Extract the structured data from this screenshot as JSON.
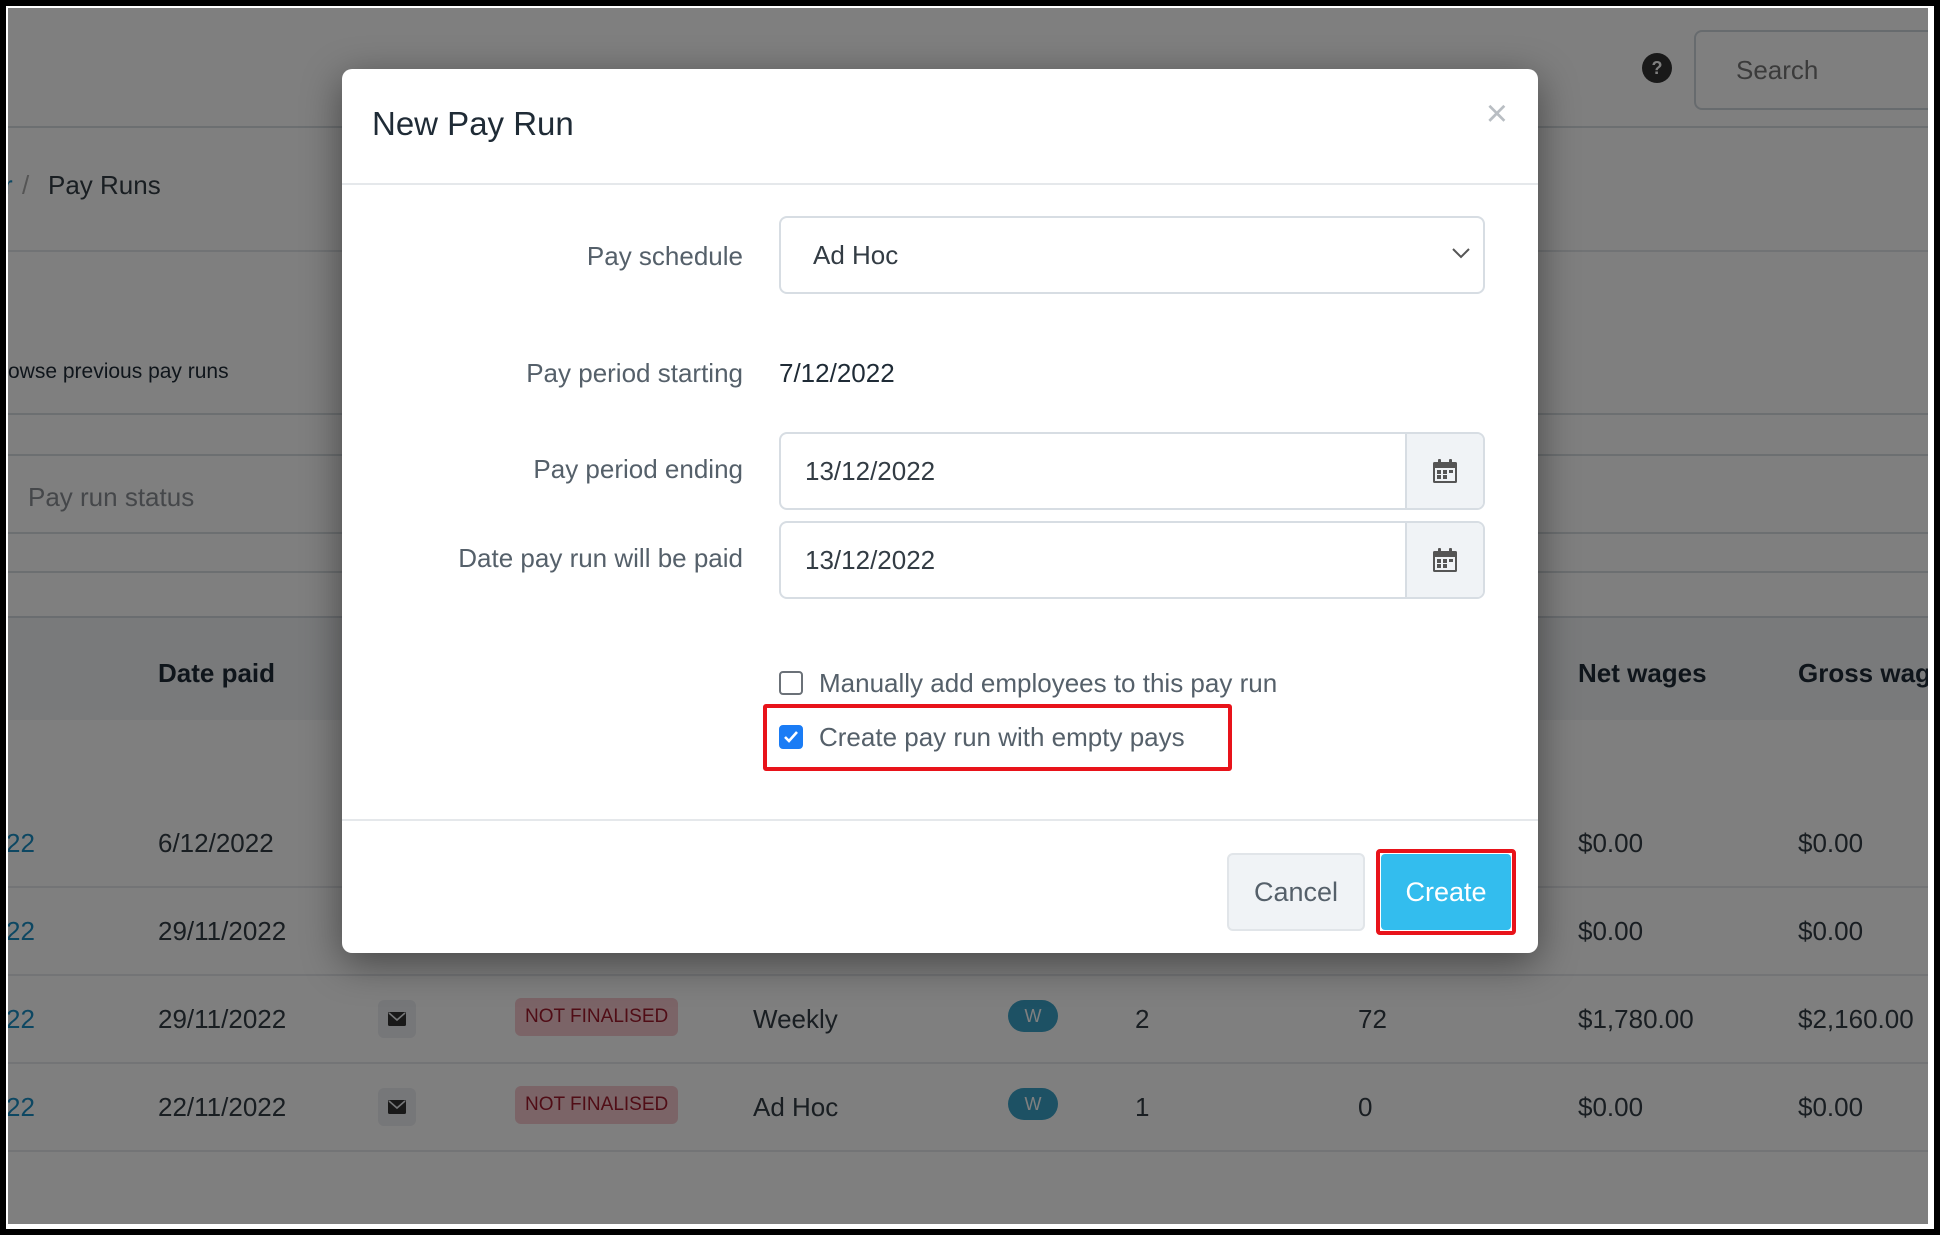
{
  "header": {
    "help_icon": "question-circle-icon",
    "help_glyph": "?",
    "search_placeholder": "Search"
  },
  "breadcrumb": {
    "previous": "r",
    "separator": "/",
    "current": "Pay Runs"
  },
  "background": {
    "browse_text": "owse previous pay runs",
    "status_filter_placeholder": "Pay run status",
    "table": {
      "columns": [
        "Date paid",
        "Net wages",
        "Gross wage"
      ],
      "rows": [
        {
          "id_fragment": "22",
          "date_paid": "6/12/2022",
          "net_wages": "$0.00",
          "gross_wages": "$0.00"
        },
        {
          "id_fragment": "22",
          "date_paid": "29/11/2022",
          "net_wages": "$0.00",
          "gross_wages": "$0.00"
        },
        {
          "id_fragment": "22",
          "date_paid": "29/11/2022",
          "email_icon": "envelope-icon",
          "status": "NOT FINALISED",
          "schedule": "Weekly",
          "frequency_badge": "W",
          "employees": "2",
          "hours": "72",
          "net_wages": "$1,780.00",
          "gross_wages": "$2,160.00"
        },
        {
          "id_fragment": "22",
          "date_paid": "22/11/2022",
          "email_icon": "envelope-icon",
          "status": "NOT FINALISED",
          "schedule": "Ad Hoc",
          "frequency_badge": "W",
          "employees": "1",
          "hours": "0",
          "net_wages": "$0.00",
          "gross_wages": "$0.00"
        }
      ]
    }
  },
  "modal": {
    "title": "New Pay Run",
    "close_glyph": "×",
    "fields": {
      "pay_schedule": {
        "label": "Pay schedule",
        "value": "Ad Hoc"
      },
      "pay_period_starting": {
        "label": "Pay period starting",
        "value": "7/12/2022"
      },
      "pay_period_ending": {
        "label": "Pay period ending",
        "value": "13/12/2022"
      },
      "date_paid": {
        "label": "Date pay run will be paid",
        "value": "13/12/2022"
      }
    },
    "options": {
      "manually_add": {
        "label": "Manually add employees to this pay run",
        "checked": false
      },
      "empty_pays": {
        "label": "Create pay run with empty pays",
        "checked": true
      }
    },
    "buttons": {
      "cancel": "Cancel",
      "create": "Create"
    }
  },
  "colors": {
    "primary_button": "#33bdee",
    "checkbox_checked": "#1a7cf5",
    "highlight": "#e8131a",
    "status_not_finalised": "#a01a2c",
    "link": "#1a8fc5"
  }
}
